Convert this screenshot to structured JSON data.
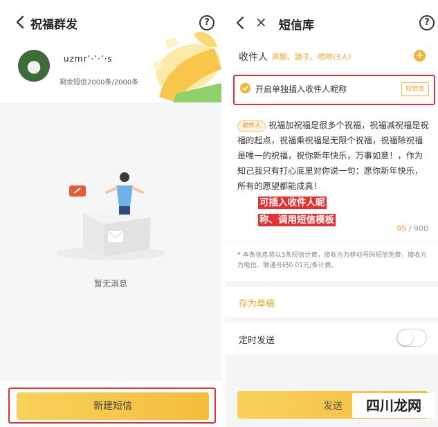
{
  "left": {
    "header": {
      "title": "祝福群发",
      "help": "?"
    },
    "account": {
      "username": "uzmr’·’·’·s",
      "quota": "剩余短信2000条/2000条"
    },
    "empty": {
      "text": "暂无消息"
    },
    "footer": {
      "new_button": "新建短信"
    }
  },
  "right": {
    "header": {
      "close": "×",
      "title": "短信库",
      "help": "?"
    },
    "recipient": {
      "label": "收件人",
      "names": "声鹏、蹄子、唠唠(3人)",
      "add": "+"
    },
    "nickname": {
      "text": "开启单独插入收件人昵称",
      "library_button": "短信库"
    },
    "message": {
      "tag": "收件人",
      "body": "祝福加祝福是很多个祝福，祝福减祝福是祝福的起点，祝福乘祝福是无限个祝福，祝福除祝福是唯一的祝福，祝你新年快乐，万事如意！，作为知己我只有打心底里对你说一句：愿你新年快乐，所有的愿望都能成真！",
      "annotation_line1": "可插入收件人昵",
      "annotation_line2": "称、调用短信模板",
      "count_current": "95",
      "count_sep": " / ",
      "count_max": "900"
    },
    "notice": {
      "star": "*",
      "text": "本条信息将以3条短信计费，接收方为移动号码短信免费，接收方为电信、联通号码0.01元/条计费。"
    },
    "draft": {
      "label": "存为草稿"
    },
    "timer": {
      "label": "定时发送",
      "enabled": false
    },
    "send": {
      "label": "发送"
    },
    "watermark": "四川龙网"
  },
  "colors": {
    "accent": "#f4a72a",
    "button": "#f6c84a",
    "highlight": "#e53030"
  }
}
